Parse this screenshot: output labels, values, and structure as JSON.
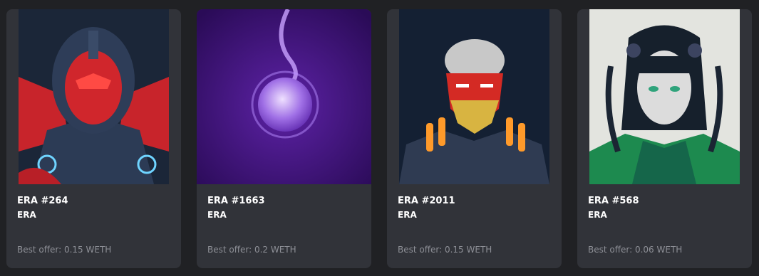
{
  "cards": [
    {
      "title": "ERA #264",
      "collection": "ERA",
      "offer": "Best offer: 0.15 WETH",
      "art": "red-helmet-cyborg-artwork"
    },
    {
      "title": "ERA #1663",
      "collection": "ERA",
      "offer": "Best offer: 0.2 WETH",
      "art": "purple-orb-artwork"
    },
    {
      "title": "ERA #2011",
      "collection": "ERA",
      "offer": "Best offer: 0.15 WETH",
      "art": "oni-mask-warrior-artwork"
    },
    {
      "title": "ERA #568",
      "collection": "ERA",
      "offer": "Best offer: 0.06 WETH",
      "art": "pale-cyber-girl-artwork"
    }
  ]
}
